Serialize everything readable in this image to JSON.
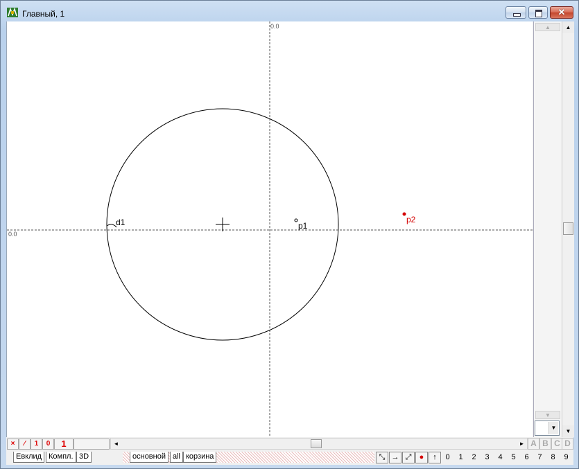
{
  "window": {
    "title": "Главный, 1",
    "close_glyph": "✕"
  },
  "canvas": {
    "axis_top_label": "0.0",
    "axis_left_label": "0.0",
    "labels": {
      "d1": "d1",
      "p1": "p1",
      "p2": "p2"
    },
    "accent_color": "#d40000"
  },
  "vscroll": {
    "up": "▲",
    "down": "▼",
    "combo_arrow": "▼"
  },
  "status": {
    "buttons": [
      "×",
      "⁄",
      "1",
      "0"
    ],
    "layer_number": "1"
  },
  "hscroll": {
    "left": "◄",
    "right": "►"
  },
  "letters": [
    "A",
    "B",
    "C",
    "D"
  ],
  "tabs": {
    "left": [
      "Евклид",
      "Компл.",
      "3D"
    ],
    "right": [
      "основной",
      "all",
      "корзина"
    ]
  },
  "tools": [
    "⤡",
    "→",
    "⤢",
    "●",
    "↑"
  ],
  "numbers": [
    "0",
    "1",
    "2",
    "3",
    "4",
    "5",
    "6",
    "7",
    "8",
    "9"
  ]
}
